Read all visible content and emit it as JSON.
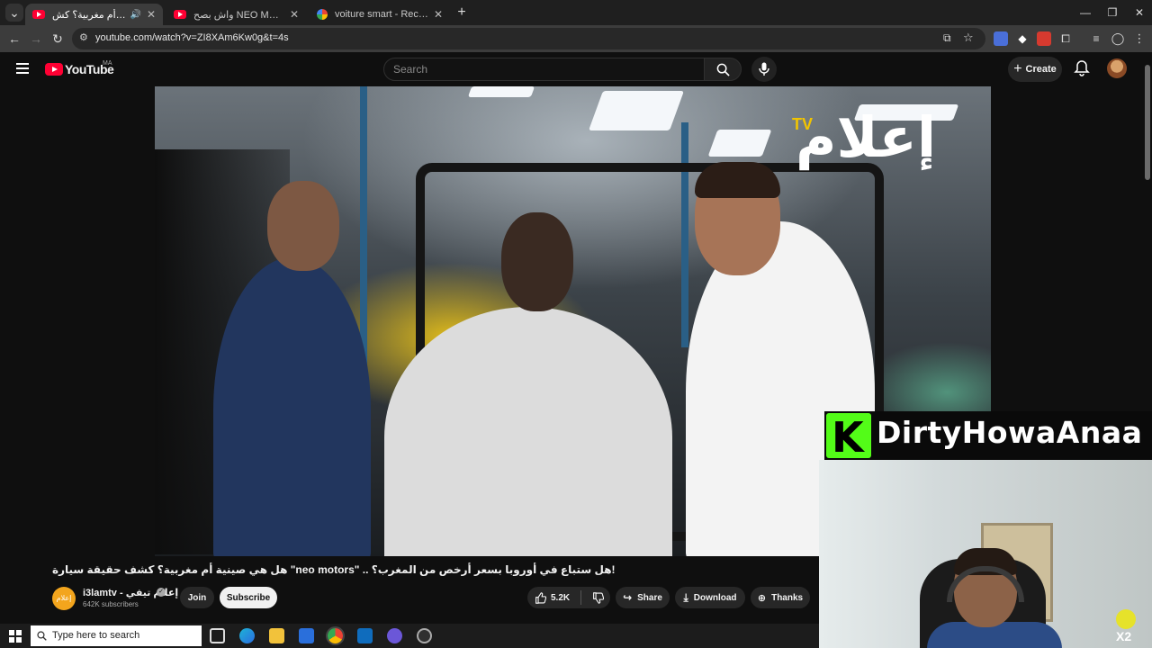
{
  "browser": {
    "tabs": [
      {
        "title": "هل هي صينية أم مغربية؟ كش",
        "favicon": "youtube-icon",
        "audio": true,
        "active": true
      },
      {
        "title": "واش بصح NEO MOTORS حقيقة",
        "favicon": "youtube-icon",
        "active": false
      },
      {
        "title": "voiture smart - Recherche Goog",
        "favicon": "google-icon",
        "active": false
      }
    ],
    "new_tab": "+",
    "url": "youtube.com/watch?v=ZI8XAm6Kw0g&t=4s"
  },
  "youtube": {
    "logo_text": "YouTube",
    "country_code": "MA",
    "search_placeholder": "Search",
    "create_label": "Create"
  },
  "video": {
    "watermark_text": "إعلام",
    "watermark_tv": "TV",
    "title": "!هل ستباع في أوروبا بسعر أرخص من المغرب؟ .. \"neo motors\" هل هي صينية أم مغربية؟ كشف حقيقة سيارة"
  },
  "channel": {
    "name": "i3lamtv - إعلام تيفي",
    "avatar_text": "إعلام",
    "subscribers": "642K subscribers",
    "join_label": "Join",
    "subscribe_label": "Subscribe"
  },
  "actions": {
    "likes": "5.2K",
    "share_label": "Share",
    "download_label": "Download",
    "thanks_label": "Thanks"
  },
  "overlay": {
    "kick_letter": "K",
    "streamer_name": "DirtyHowaAnaa",
    "emote_text": "X2"
  },
  "taskbar": {
    "search_placeholder": "Type here to search"
  },
  "colors": {
    "youtube_red": "#ff0033",
    "kick_green": "#53fc18",
    "background": "#0f0f0f"
  }
}
